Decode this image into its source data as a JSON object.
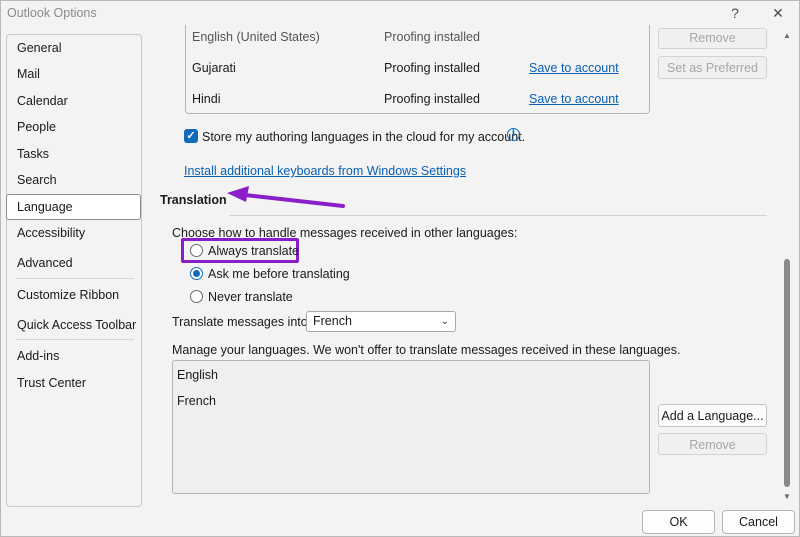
{
  "window": {
    "title": "Outlook Options",
    "help_label": "?",
    "close_label": "✕"
  },
  "sidebar": {
    "items": [
      {
        "label": "General"
      },
      {
        "label": "Mail"
      },
      {
        "label": "Calendar"
      },
      {
        "label": "People"
      },
      {
        "label": "Tasks"
      },
      {
        "label": "Search"
      },
      {
        "label": "Language",
        "selected": true
      },
      {
        "label": "Accessibility"
      },
      {
        "label": "Advanced"
      },
      {
        "label": "Customize Ribbon"
      },
      {
        "label": "Quick Access Toolbar"
      },
      {
        "label": "Add-ins"
      },
      {
        "label": "Trust Center"
      }
    ]
  },
  "proofing": {
    "rows": [
      {
        "language": "English (United States)",
        "status": "Proofing installed",
        "action": ""
      },
      {
        "language": "Gujarati",
        "status": "Proofing installed",
        "action": "Save to account"
      },
      {
        "language": "Hindi",
        "status": "Proofing installed",
        "action": "Save to account"
      }
    ],
    "remove_label": "Remove",
    "set_preferred_label": "Set as Preferred",
    "store_cloud_label": "Store my authoring languages in the cloud for my account.",
    "store_cloud_checked": true,
    "install_keyboards_link": "Install additional keyboards from Windows Settings"
  },
  "translation": {
    "header": "Translation",
    "prompt": "Choose how to handle messages received in other languages:",
    "options": [
      {
        "label": "Always translate",
        "checked": false
      },
      {
        "label": "Ask me before translating",
        "checked": true
      },
      {
        "label": "Never translate",
        "checked": false
      }
    ],
    "translate_into_label": "Translate messages into:",
    "translate_into_value": "French",
    "manage_label": "Manage your languages. We won't offer to translate messages received in these languages.",
    "languages": [
      "English",
      "French"
    ],
    "add_language_label": "Add a Language...",
    "remove_label": "Remove"
  },
  "footer": {
    "ok_label": "OK",
    "cancel_label": "Cancel"
  },
  "colors": {
    "accent": "#0f6cbd",
    "link": "#0a5fb6",
    "annotation": "#8a1ec8"
  }
}
